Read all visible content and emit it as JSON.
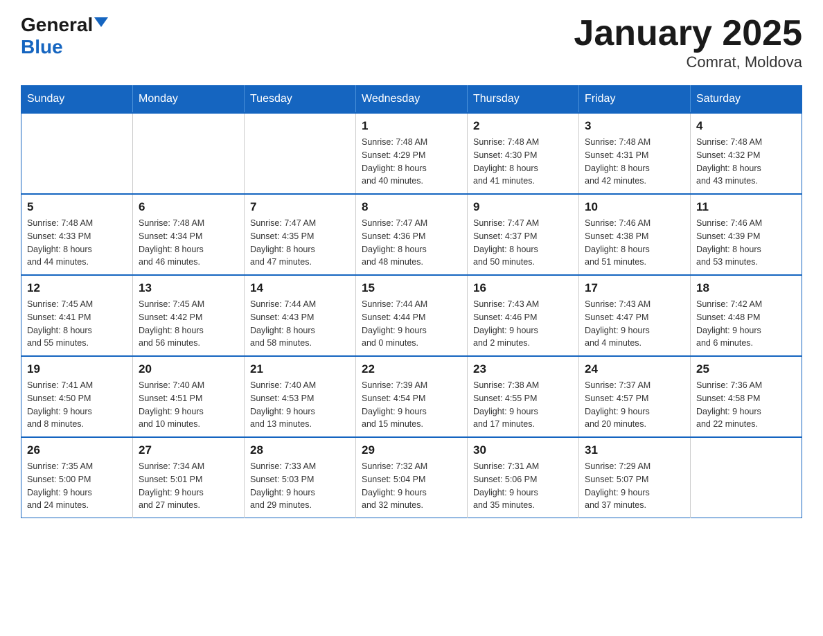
{
  "header": {
    "logo_general": "General",
    "logo_blue": "Blue",
    "title": "January 2025",
    "subtitle": "Comrat, Moldova"
  },
  "weekdays": [
    "Sunday",
    "Monday",
    "Tuesday",
    "Wednesday",
    "Thursday",
    "Friday",
    "Saturday"
  ],
  "weeks": [
    [
      {
        "day": "",
        "info": ""
      },
      {
        "day": "",
        "info": ""
      },
      {
        "day": "",
        "info": ""
      },
      {
        "day": "1",
        "info": "Sunrise: 7:48 AM\nSunset: 4:29 PM\nDaylight: 8 hours\nand 40 minutes."
      },
      {
        "day": "2",
        "info": "Sunrise: 7:48 AM\nSunset: 4:30 PM\nDaylight: 8 hours\nand 41 minutes."
      },
      {
        "day": "3",
        "info": "Sunrise: 7:48 AM\nSunset: 4:31 PM\nDaylight: 8 hours\nand 42 minutes."
      },
      {
        "day": "4",
        "info": "Sunrise: 7:48 AM\nSunset: 4:32 PM\nDaylight: 8 hours\nand 43 minutes."
      }
    ],
    [
      {
        "day": "5",
        "info": "Sunrise: 7:48 AM\nSunset: 4:33 PM\nDaylight: 8 hours\nand 44 minutes."
      },
      {
        "day": "6",
        "info": "Sunrise: 7:48 AM\nSunset: 4:34 PM\nDaylight: 8 hours\nand 46 minutes."
      },
      {
        "day": "7",
        "info": "Sunrise: 7:47 AM\nSunset: 4:35 PM\nDaylight: 8 hours\nand 47 minutes."
      },
      {
        "day": "8",
        "info": "Sunrise: 7:47 AM\nSunset: 4:36 PM\nDaylight: 8 hours\nand 48 minutes."
      },
      {
        "day": "9",
        "info": "Sunrise: 7:47 AM\nSunset: 4:37 PM\nDaylight: 8 hours\nand 50 minutes."
      },
      {
        "day": "10",
        "info": "Sunrise: 7:46 AM\nSunset: 4:38 PM\nDaylight: 8 hours\nand 51 minutes."
      },
      {
        "day": "11",
        "info": "Sunrise: 7:46 AM\nSunset: 4:39 PM\nDaylight: 8 hours\nand 53 minutes."
      }
    ],
    [
      {
        "day": "12",
        "info": "Sunrise: 7:45 AM\nSunset: 4:41 PM\nDaylight: 8 hours\nand 55 minutes."
      },
      {
        "day": "13",
        "info": "Sunrise: 7:45 AM\nSunset: 4:42 PM\nDaylight: 8 hours\nand 56 minutes."
      },
      {
        "day": "14",
        "info": "Sunrise: 7:44 AM\nSunset: 4:43 PM\nDaylight: 8 hours\nand 58 minutes."
      },
      {
        "day": "15",
        "info": "Sunrise: 7:44 AM\nSunset: 4:44 PM\nDaylight: 9 hours\nand 0 minutes."
      },
      {
        "day": "16",
        "info": "Sunrise: 7:43 AM\nSunset: 4:46 PM\nDaylight: 9 hours\nand 2 minutes."
      },
      {
        "day": "17",
        "info": "Sunrise: 7:43 AM\nSunset: 4:47 PM\nDaylight: 9 hours\nand 4 minutes."
      },
      {
        "day": "18",
        "info": "Sunrise: 7:42 AM\nSunset: 4:48 PM\nDaylight: 9 hours\nand 6 minutes."
      }
    ],
    [
      {
        "day": "19",
        "info": "Sunrise: 7:41 AM\nSunset: 4:50 PM\nDaylight: 9 hours\nand 8 minutes."
      },
      {
        "day": "20",
        "info": "Sunrise: 7:40 AM\nSunset: 4:51 PM\nDaylight: 9 hours\nand 10 minutes."
      },
      {
        "day": "21",
        "info": "Sunrise: 7:40 AM\nSunset: 4:53 PM\nDaylight: 9 hours\nand 13 minutes."
      },
      {
        "day": "22",
        "info": "Sunrise: 7:39 AM\nSunset: 4:54 PM\nDaylight: 9 hours\nand 15 minutes."
      },
      {
        "day": "23",
        "info": "Sunrise: 7:38 AM\nSunset: 4:55 PM\nDaylight: 9 hours\nand 17 minutes."
      },
      {
        "day": "24",
        "info": "Sunrise: 7:37 AM\nSunset: 4:57 PM\nDaylight: 9 hours\nand 20 minutes."
      },
      {
        "day": "25",
        "info": "Sunrise: 7:36 AM\nSunset: 4:58 PM\nDaylight: 9 hours\nand 22 minutes."
      }
    ],
    [
      {
        "day": "26",
        "info": "Sunrise: 7:35 AM\nSunset: 5:00 PM\nDaylight: 9 hours\nand 24 minutes."
      },
      {
        "day": "27",
        "info": "Sunrise: 7:34 AM\nSunset: 5:01 PM\nDaylight: 9 hours\nand 27 minutes."
      },
      {
        "day": "28",
        "info": "Sunrise: 7:33 AM\nSunset: 5:03 PM\nDaylight: 9 hours\nand 29 minutes."
      },
      {
        "day": "29",
        "info": "Sunrise: 7:32 AM\nSunset: 5:04 PM\nDaylight: 9 hours\nand 32 minutes."
      },
      {
        "day": "30",
        "info": "Sunrise: 7:31 AM\nSunset: 5:06 PM\nDaylight: 9 hours\nand 35 minutes."
      },
      {
        "day": "31",
        "info": "Sunrise: 7:29 AM\nSunset: 5:07 PM\nDaylight: 9 hours\nand 37 minutes."
      },
      {
        "day": "",
        "info": ""
      }
    ]
  ]
}
